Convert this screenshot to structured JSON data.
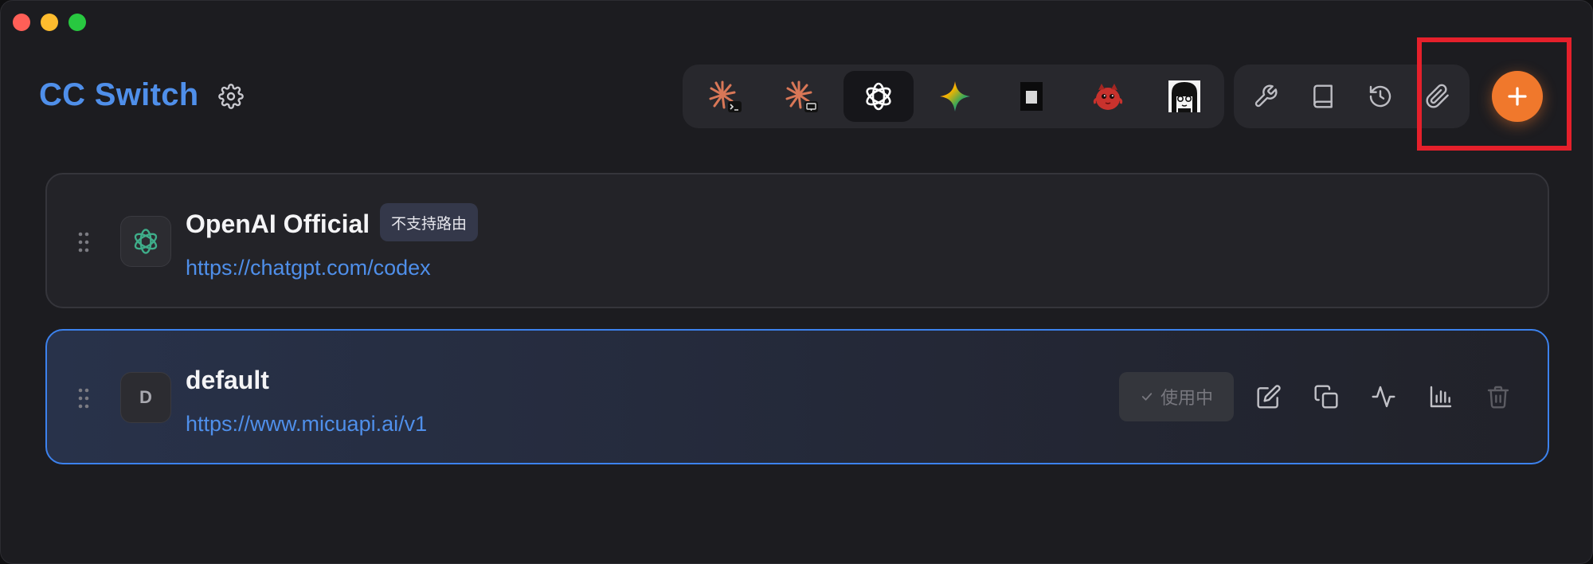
{
  "window": {
    "controls": [
      "close",
      "minimize",
      "zoom"
    ]
  },
  "header": {
    "title": "CC Switch",
    "settings_icon": "gear-icon"
  },
  "app_switcher": {
    "tabs": [
      {
        "name": "claude-code-cli",
        "icon": "claude-burst-terminal-icon",
        "active": false
      },
      {
        "name": "claude-desktop",
        "icon": "claude-burst-desktop-icon",
        "active": false
      },
      {
        "name": "openai-codex",
        "icon": "openai-logo-icon",
        "active": true
      },
      {
        "name": "gemini",
        "icon": "gemini-sparkle-icon",
        "active": false
      },
      {
        "name": "opencode",
        "icon": "opencode-square-icon",
        "active": false
      },
      {
        "name": "red-mascot-app",
        "icon": "red-mascot-icon",
        "active": false
      },
      {
        "name": "anime-avatar-app",
        "icon": "anime-avatar-icon",
        "active": false
      }
    ]
  },
  "toolbar": {
    "tools": [
      {
        "name": "tools",
        "icon": "wrench-icon"
      },
      {
        "name": "docs",
        "icon": "book-icon"
      },
      {
        "name": "history",
        "icon": "history-icon"
      },
      {
        "name": "attachments",
        "icon": "paperclip-icon"
      }
    ],
    "add_icon": "plus-icon",
    "accent": "#f0782c",
    "highlight_color": "#e5202b"
  },
  "providers": [
    {
      "name": "OpenAI Official",
      "url": "https://chatgpt.com/codex",
      "badge": "不支持路由",
      "icon": "openai-logo-icon",
      "active": false
    },
    {
      "name": "default",
      "url": "https://www.micuapi.ai/v1",
      "initial": "D",
      "active": true,
      "status_label": "使用中",
      "actions": [
        "edit-icon",
        "copy-icon",
        "activity-icon",
        "stats-icon",
        "trash-icon"
      ]
    }
  ],
  "colors": {
    "title_blue": "#4f8fea",
    "active_border": "#3c82ee",
    "background": "#1c1c20"
  }
}
